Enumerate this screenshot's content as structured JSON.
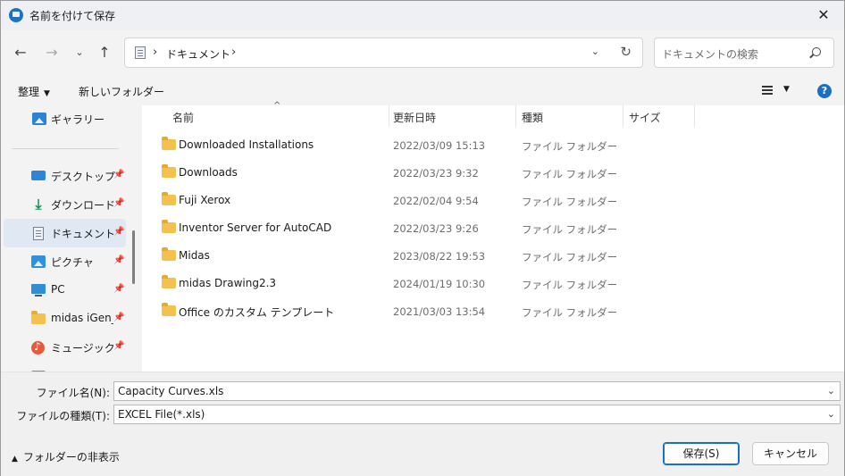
{
  "window": {
    "title": "名前を付けて保存",
    "close_icon": "close-icon"
  },
  "nav": {
    "back_icon": "back-arrow-icon",
    "forward_icon": "forward-arrow-icon",
    "recent_icon": "chevron-down-icon",
    "up_icon": "up-arrow-icon",
    "address_path": "ドキュメント",
    "search_placeholder": "ドキュメントの検索"
  },
  "commandbar": {
    "organize_label": "整理",
    "new_folder_label": "新しいフォルダー",
    "help_label": "?"
  },
  "sidebar": {
    "items": [
      {
        "label": "ギャラリー",
        "icon": "gallery-icon",
        "pinned": false
      },
      {
        "label": "デスクトップ",
        "icon": "desktop-icon",
        "pinned": true
      },
      {
        "label": "ダウンロード",
        "icon": "download-icon",
        "pinned": true
      },
      {
        "label": "ドキュメント",
        "icon": "documents-icon",
        "pinned": true,
        "selected": true
      },
      {
        "label": "ピクチャ",
        "icon": "pictures-icon",
        "pinned": true
      },
      {
        "label": "PC",
        "icon": "pc-icon",
        "pinned": true
      },
      {
        "label": "midas iGen_V",
        "icon": "folder-icon",
        "pinned": true
      },
      {
        "label": "ミュージック",
        "icon": "music-icon",
        "pinned": true
      }
    ]
  },
  "filelist": {
    "columns": {
      "name": "名前",
      "date": "更新日時",
      "type": "種類",
      "size": "サイズ"
    },
    "rows": [
      {
        "name": "Downloaded Installations",
        "date": "2022/03/09 15:13",
        "type": "ファイル フォルダー"
      },
      {
        "name": "Downloads",
        "date": "2022/03/23 9:32",
        "type": "ファイル フォルダー"
      },
      {
        "name": "Fuji Xerox",
        "date": "2022/02/04 9:54",
        "type": "ファイル フォルダー"
      },
      {
        "name": "Inventor Server for AutoCAD",
        "date": "2022/03/23 9:26",
        "type": "ファイル フォルダー"
      },
      {
        "name": "Midas",
        "date": "2023/08/22 19:53",
        "type": "ファイル フォルダー"
      },
      {
        "name": "midas Drawing2.3",
        "date": "2024/01/19 10:30",
        "type": "ファイル フォルダー"
      },
      {
        "name": "Office のカスタム テンプレート",
        "date": "2021/03/03 13:54",
        "type": "ファイル フォルダー"
      }
    ]
  },
  "form": {
    "filename_label": "ファイル名(N):",
    "filename_value": "Capacity Curves.xls",
    "filetype_label": "ファイルの種類(T):",
    "filetype_value": "EXCEL File(*.xls)"
  },
  "footer": {
    "hide_folders_label": "フォルダーの非表示",
    "save_label": "保存(S)",
    "cancel_label": "キャンセル"
  }
}
